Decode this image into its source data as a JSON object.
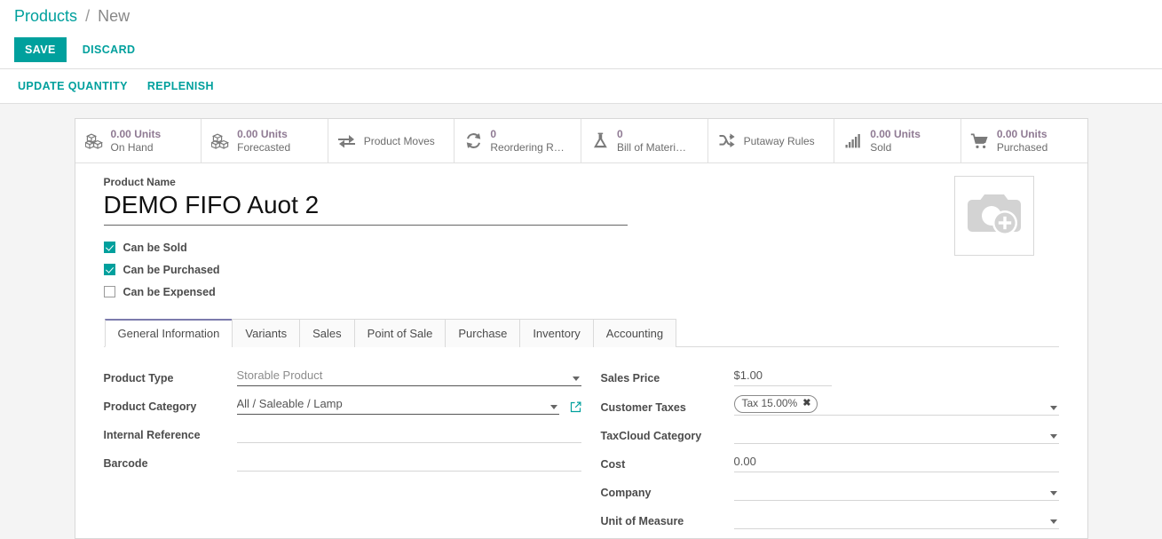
{
  "breadcrumb": {
    "root": "Products",
    "separator": "/",
    "current": "New"
  },
  "controlpanel": {
    "save_label": "SAVE",
    "discard_label": "DISCARD"
  },
  "actionbar": {
    "buttons": [
      {
        "label": "UPDATE QUANTITY"
      },
      {
        "label": "REPLENISH"
      }
    ]
  },
  "stat_buttons": [
    {
      "value": "0.00 Units",
      "label": "On Hand",
      "icon": "cubes-icon"
    },
    {
      "value": "0.00 Units",
      "label": "Forecasted",
      "icon": "cubes-icon"
    },
    {
      "value": "",
      "label": "Product Moves",
      "icon": "exchange-arrows-icon"
    },
    {
      "value": "0",
      "label": "Reordering R…",
      "icon": "refresh-icon"
    },
    {
      "value": "0",
      "label": "Bill of Materi…",
      "icon": "flask-icon"
    },
    {
      "value": "",
      "label": "Putaway Rules",
      "icon": "shuffle-icon"
    },
    {
      "value": "0.00 Units",
      "label": "Sold",
      "icon": "bar-chart-icon"
    },
    {
      "value": "0.00 Units",
      "label": "Purchased",
      "icon": "shopping-cart-icon"
    }
  ],
  "title": {
    "label": "Product Name",
    "value": "DEMO FIFO Auot 2",
    "placeholder": "e.g. Cheese Burger"
  },
  "image": {
    "icon": "camera-add-icon"
  },
  "checkboxes": [
    {
      "label": "Can be Sold",
      "checked": true
    },
    {
      "label": "Can be Purchased",
      "checked": true
    },
    {
      "label": "Can be Expensed",
      "checked": false
    }
  ],
  "tabs": [
    {
      "label": "General Information",
      "active": true
    },
    {
      "label": "Variants",
      "active": false
    },
    {
      "label": "Sales",
      "active": false
    },
    {
      "label": "Point of Sale",
      "active": false
    },
    {
      "label": "Purchase",
      "active": false
    },
    {
      "label": "Inventory",
      "active": false
    },
    {
      "label": "Accounting",
      "active": false
    }
  ],
  "fields_left": [
    {
      "label": "Product Type",
      "value": "Storable Product",
      "type": "select"
    },
    {
      "label": "Product Category",
      "value": "All / Saleable / Lamp",
      "type": "many2one"
    },
    {
      "label": "Internal Reference",
      "value": "",
      "type": "text"
    },
    {
      "label": "Barcode",
      "value": "",
      "type": "text"
    }
  ],
  "fields_right": [
    {
      "label": "Sales Price",
      "value": "$1.00",
      "type": "monetary"
    },
    {
      "label": "Customer Taxes",
      "value": "",
      "type": "tags",
      "tag": "Tax 15.00%",
      "tag_remove": "✖"
    },
    {
      "label": "TaxCloud Category",
      "value": "",
      "type": "many2one"
    },
    {
      "label": "Cost",
      "value": "0.00",
      "type": "monetary"
    },
    {
      "label": "Company",
      "value": "",
      "type": "many2one"
    },
    {
      "label": "Unit of Measure",
      "value": "",
      "type": "many2one"
    }
  ],
  "colors": {
    "accent": "#00a09d",
    "brand_purple": "#7c7bad",
    "stat_value": "#8f7a93",
    "page_bg": "#f4f4f4"
  }
}
